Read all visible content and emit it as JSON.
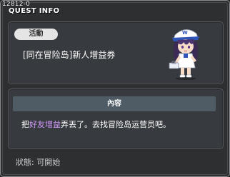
{
  "quest_id": "12812-0",
  "title": "QUEST INFO",
  "category_pill": "活動",
  "quest_name": "[同在冒险岛]新人增益券",
  "content_header": "內容",
  "content_text": {
    "before": "把",
    "highlight": "好友增益",
    "after": "弄丟了。去找冒险岛运营员吧。"
  },
  "status": "狀態: 可開始",
  "colors": {
    "frame_bg": "#2d2f31",
    "panel_bg": "#373a3e",
    "header_bg": "#4f5c66",
    "highlight": "#d59cff"
  },
  "icons": {
    "npc": "maple-guide-npc-portrait"
  }
}
